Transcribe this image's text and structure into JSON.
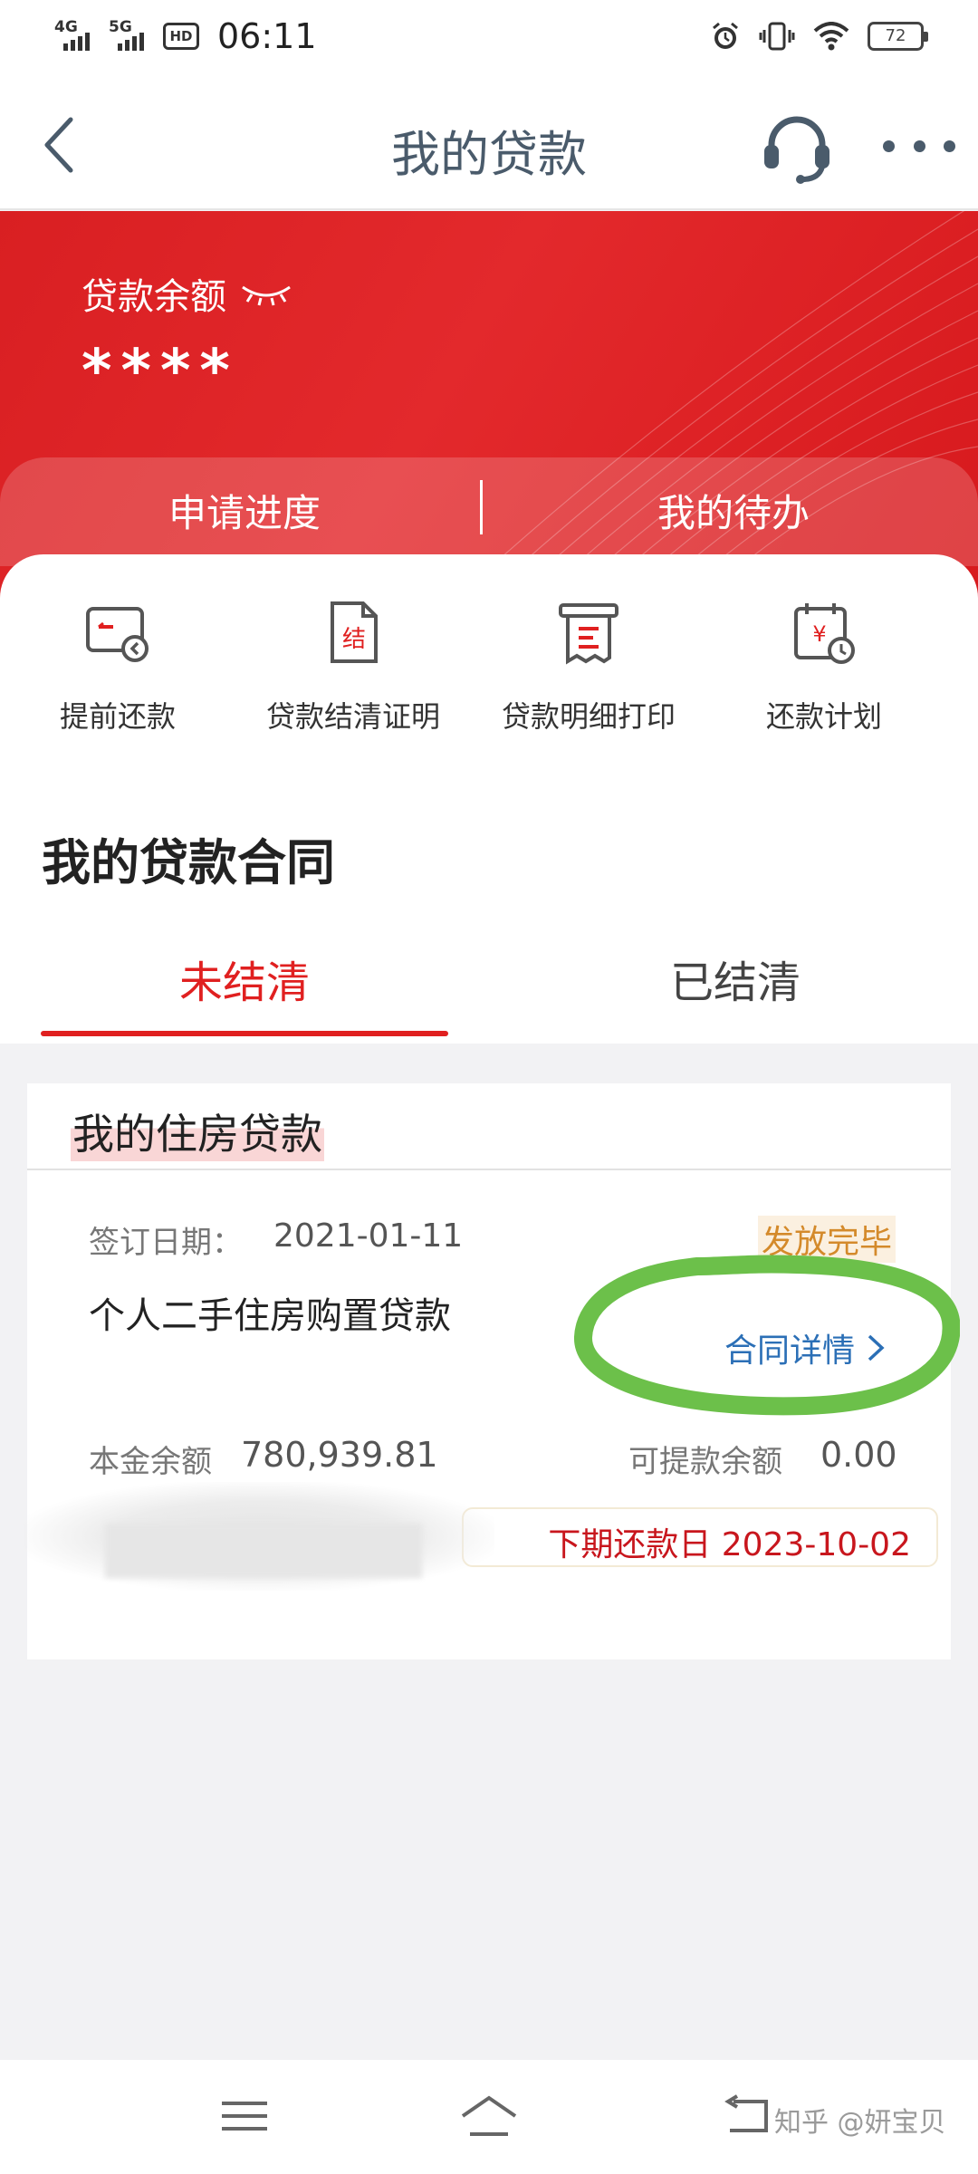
{
  "status_bar": {
    "net1": "4G",
    "net2": "5G",
    "hd_badge": "HD",
    "time": "06:11",
    "battery": "72"
  },
  "nav": {
    "title": "我的贷款"
  },
  "banner": {
    "balance_label": "贷款余额",
    "balance_value": "****",
    "tabs": [
      "申请进度",
      "我的待办"
    ]
  },
  "quick_actions": [
    {
      "label": "提前还款",
      "icon": "prepay-icon"
    },
    {
      "label": "贷款结清证明",
      "icon": "settlement-certificate-icon"
    },
    {
      "label": "贷款明细打印",
      "icon": "print-receipt-icon"
    },
    {
      "label": "还款计划",
      "icon": "repayment-calendar-icon"
    }
  ],
  "contracts": {
    "title": "我的贷款合同",
    "tabs": [
      "未结清",
      "已结清"
    ],
    "active_tab": "未结清"
  },
  "loan_card": {
    "title": "我的住房贷款",
    "sign_label": "签订日期：",
    "sign_date": "2021-01-11",
    "status": "发放完毕",
    "loan_name": "个人二手住房购置贷款",
    "contract_link": "合同详情",
    "principal_label": "本金余额",
    "principal_value": "780,939.81",
    "available_label": "可提款余额",
    "available_value": "0.00",
    "next_payment": "下期还款日 2023-10-02"
  },
  "watermark": "知乎 @妍宝贝",
  "colors": {
    "brand_red": "#e02020",
    "link_blue": "#2b6fb6",
    "status_orange": "#d48a2b",
    "annotation_green": "#6cc04a"
  }
}
